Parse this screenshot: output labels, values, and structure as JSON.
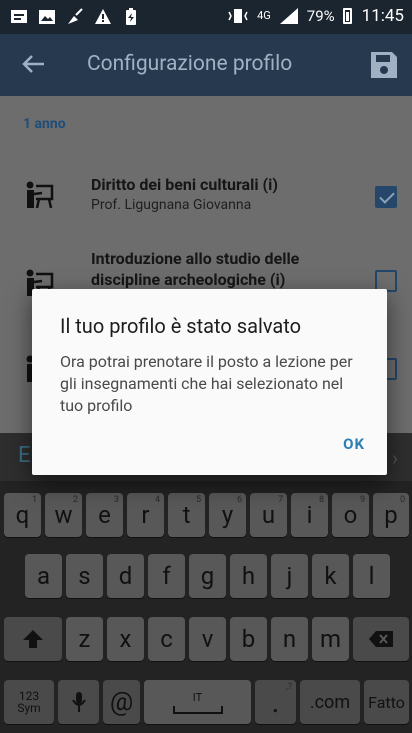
{
  "status_bar": {
    "network": "4G",
    "battery": "79%",
    "time": "11:45",
    "left_icons": [
      "message-icon",
      "image-icon",
      "broom-icon",
      "warning-icon",
      "battery-saver-icon"
    ]
  },
  "appbar": {
    "title": "Configurazione profilo",
    "back_icon": "arrow-left-icon",
    "save_icon": "floppy-disk-icon"
  },
  "content": {
    "section_label": "1 anno",
    "courses": [
      {
        "title": "Diritto dei beni culturali (i)",
        "professor": "Prof. Ligugnana Giovanna",
        "checked": true
      },
      {
        "title": "Introduzione allo studio delle discipline archeologiche (i)",
        "professor": "",
        "checked": false
      },
      {
        "title": "",
        "professor": "",
        "checked": false
      }
    ]
  },
  "suggestion_bar": {
    "letter": "E",
    "arrow": "›"
  },
  "keyboard": {
    "row1": [
      {
        "k": "q",
        "h": "1"
      },
      {
        "k": "w",
        "h": "2"
      },
      {
        "k": "e",
        "h": "3"
      },
      {
        "k": "r",
        "h": "4"
      },
      {
        "k": "t",
        "h": "5"
      },
      {
        "k": "y",
        "h": "6"
      },
      {
        "k": "u",
        "h": "7"
      },
      {
        "k": "i",
        "h": "8"
      },
      {
        "k": "o",
        "h": "9"
      },
      {
        "k": "p",
        "h": "0"
      }
    ],
    "row2": [
      "a",
      "s",
      "d",
      "f",
      "g",
      "h",
      "j",
      "k",
      "l"
    ],
    "row3": [
      "z",
      "x",
      "c",
      "v",
      "b",
      "n",
      "m"
    ],
    "sym_label_top": "123",
    "sym_label_bottom": "Sym",
    "at": "@",
    "space_lang": "IT",
    "period": ".",
    "period_hint": ",?",
    "com": ".com",
    "done": "Fatto"
  },
  "dialog": {
    "title": "Il tuo profilo è stato salvato",
    "message": "Ora potrai prenotare il posto a lezione per gli insegnamenti che hai selezionato nel tuo profilo",
    "ok": "OK"
  }
}
